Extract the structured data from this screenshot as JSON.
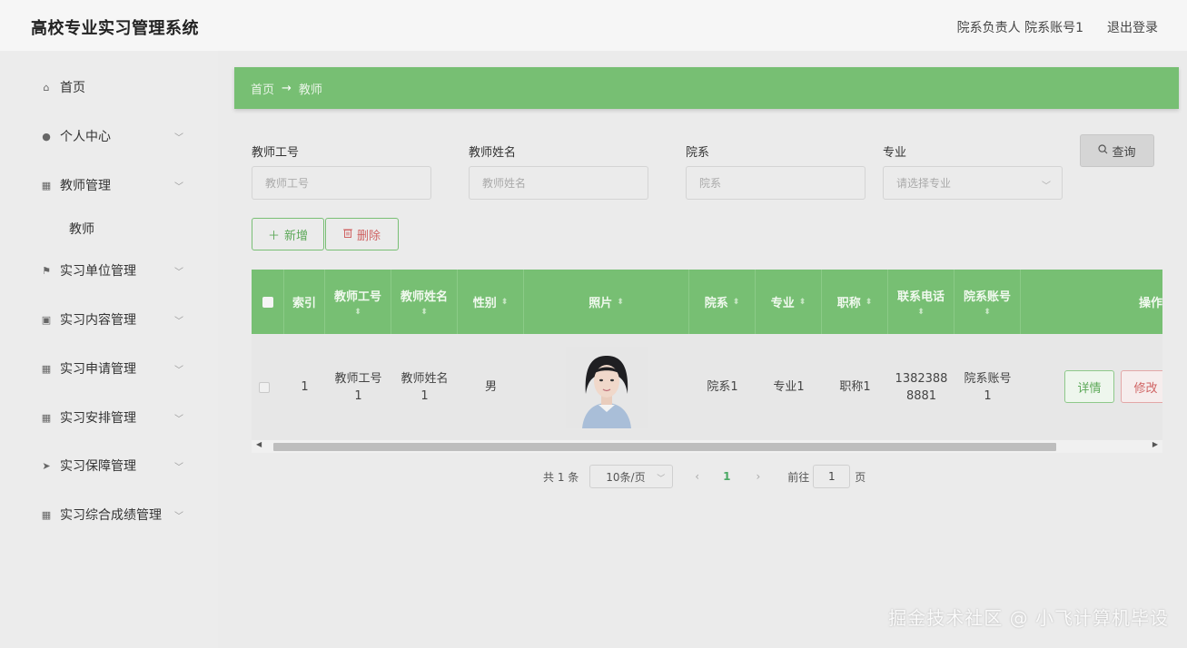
{
  "header": {
    "app_title": "高校专业实习管理系统",
    "user_info": "院系负责人 院系账号1",
    "logout": "退出登录"
  },
  "sidebar": {
    "items": [
      {
        "label": "首页",
        "icon": "home-icon",
        "glyph": "⌂",
        "has_children": false
      },
      {
        "label": "个人中心",
        "icon": "user-icon",
        "glyph": "●",
        "has_children": true
      },
      {
        "label": "教师管理",
        "icon": "grid-icon",
        "glyph": "▦",
        "has_children": true
      },
      {
        "label": "教师",
        "icon": "",
        "glyph": "",
        "has_children": false,
        "sub": true
      },
      {
        "label": "实习单位管理",
        "icon": "flag-icon",
        "glyph": "⚑",
        "has_children": true
      },
      {
        "label": "实习内容管理",
        "icon": "clipboard-icon",
        "glyph": "▣",
        "has_children": true
      },
      {
        "label": "实习申请管理",
        "icon": "grid-icon",
        "glyph": "▦",
        "has_children": true
      },
      {
        "label": "实习安排管理",
        "icon": "grid-icon",
        "glyph": "▦",
        "has_children": true
      },
      {
        "label": "实习保障管理",
        "icon": "send-icon",
        "glyph": "➤",
        "has_children": true
      },
      {
        "label": "实习综合成绩管理",
        "icon": "grid-icon",
        "glyph": "▦",
        "has_children": true
      }
    ]
  },
  "breadcrumb": {
    "home": "首页",
    "arrow": "→",
    "current": "教师"
  },
  "search": {
    "fields": [
      {
        "label": "教师工号",
        "placeholder": "教师工号",
        "type": "input"
      },
      {
        "label": "教师姓名",
        "placeholder": "教师姓名",
        "type": "input"
      },
      {
        "label": "院系",
        "placeholder": "院系",
        "type": "input"
      },
      {
        "label": "专业",
        "placeholder": "请选择专业",
        "type": "select"
      }
    ],
    "query_label": "查询",
    "query_icon": "search-icon"
  },
  "actions": {
    "add_label": "新增",
    "add_icon": "plus-icon",
    "delete_label": "删除",
    "delete_icon": "trash-icon"
  },
  "table": {
    "columns": [
      {
        "label": "",
        "type": "checkbox"
      },
      {
        "label": "索引",
        "sortable": false
      },
      {
        "label": "教师工号",
        "sortable": true
      },
      {
        "label": "教师姓名",
        "sortable": true
      },
      {
        "label": "性别",
        "sortable": true
      },
      {
        "label": "照片",
        "sortable": true
      },
      {
        "label": "院系",
        "sortable": true
      },
      {
        "label": "专业",
        "sortable": true
      },
      {
        "label": "职称",
        "sortable": true
      },
      {
        "label": "联系电话",
        "sortable": true
      },
      {
        "label": "院系账号",
        "sortable": true
      },
      {
        "label": "操作",
        "sortable": false
      }
    ],
    "rows": [
      {
        "index": "1",
        "teacher_no": "教师工号1",
        "teacher_name": "教师姓名1",
        "gender": "男",
        "photo": "portrait-photo",
        "department": "院系1",
        "major": "专业1",
        "title": "职称1",
        "phone": "13823888881",
        "account": "院系账号1",
        "detail_label": "详情",
        "edit_label": "修改"
      }
    ]
  },
  "pagination": {
    "total": "共 1 条",
    "page_size": "10条/页",
    "prev": "‹",
    "current_page": "1",
    "next": "›",
    "goto_label": "前往",
    "goto_value": "1",
    "goto_unit": "页"
  },
  "watermark": "掘金技术社区 @ 小飞计算机毕设",
  "colors": {
    "accent_green": "#77bf73",
    "danger_red": "#d06464",
    "background": "#ebebeb"
  }
}
